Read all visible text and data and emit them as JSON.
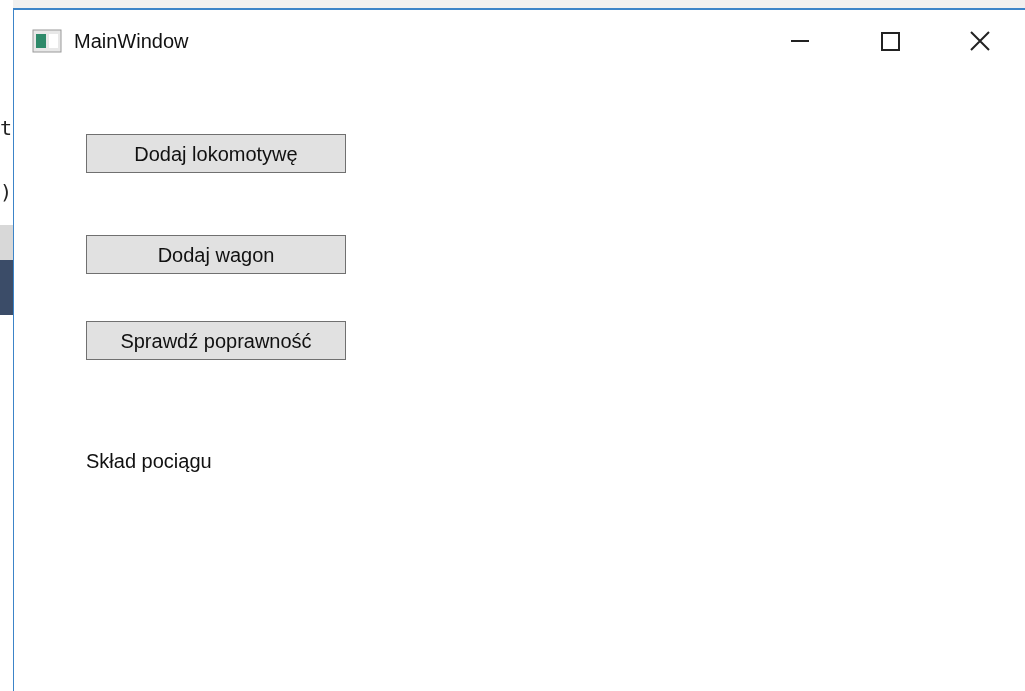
{
  "background": {
    "code_lines": [
      "t",
      ")"
    ]
  },
  "window": {
    "title": "MainWindow",
    "controls": [
      {
        "kind": "minimize"
      },
      {
        "kind": "maximize"
      },
      {
        "kind": "close"
      }
    ]
  },
  "buttons": [
    {
      "label": "Dodaj lokomotywę"
    },
    {
      "label": "Dodaj wagon"
    },
    {
      "label": "Sprawdź poprawność"
    }
  ],
  "label": "Skład pociągu"
}
